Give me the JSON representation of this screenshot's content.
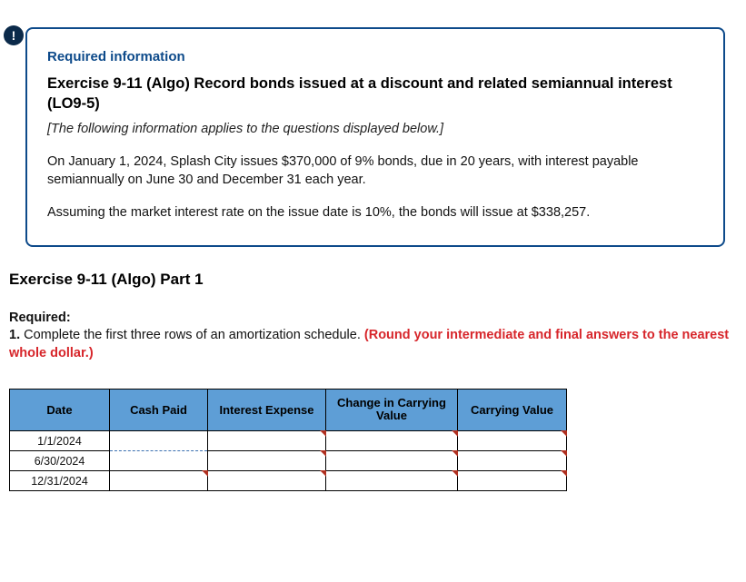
{
  "badge_char": "!",
  "info": {
    "required_info_label": "Required information",
    "exercise_title": "Exercise 9-11 (Algo) Record bonds issued at a discount and related semiannual interest (LO9-5)",
    "applies_note": "[The following information applies to the questions displayed below.]",
    "para1": "On January 1, 2024, Splash City issues $370,000 of 9% bonds, due in 20 years, with interest payable semiannually on June 30 and December 31 each year.",
    "para2": "Assuming the market interest rate on the issue date is 10%, the bonds will issue at $338,257."
  },
  "part_heading": "Exercise 9-11 (Algo) Part 1",
  "required": {
    "label": "Required:",
    "line_prefix": "1. ",
    "line_text": "Complete the first three rows of an amortization schedule. ",
    "line_red": "(Round your intermediate and final answers to the nearest whole dollar.)"
  },
  "table": {
    "headers": {
      "date": "Date",
      "cash": "Cash Paid",
      "interest": "Interest Expense",
      "change": "Change in Carrying Value",
      "carrying": "Carrying Value"
    },
    "rows": [
      {
        "date": "1/1/2024",
        "cash_disabled": true,
        "interest": "",
        "change": "",
        "carrying": ""
      },
      {
        "date": "6/30/2024",
        "cash_disabled": true,
        "interest": "",
        "change": "",
        "carrying": ""
      },
      {
        "date": "12/31/2024",
        "cash_disabled": false,
        "interest": "",
        "change": "",
        "carrying": ""
      }
    ]
  }
}
